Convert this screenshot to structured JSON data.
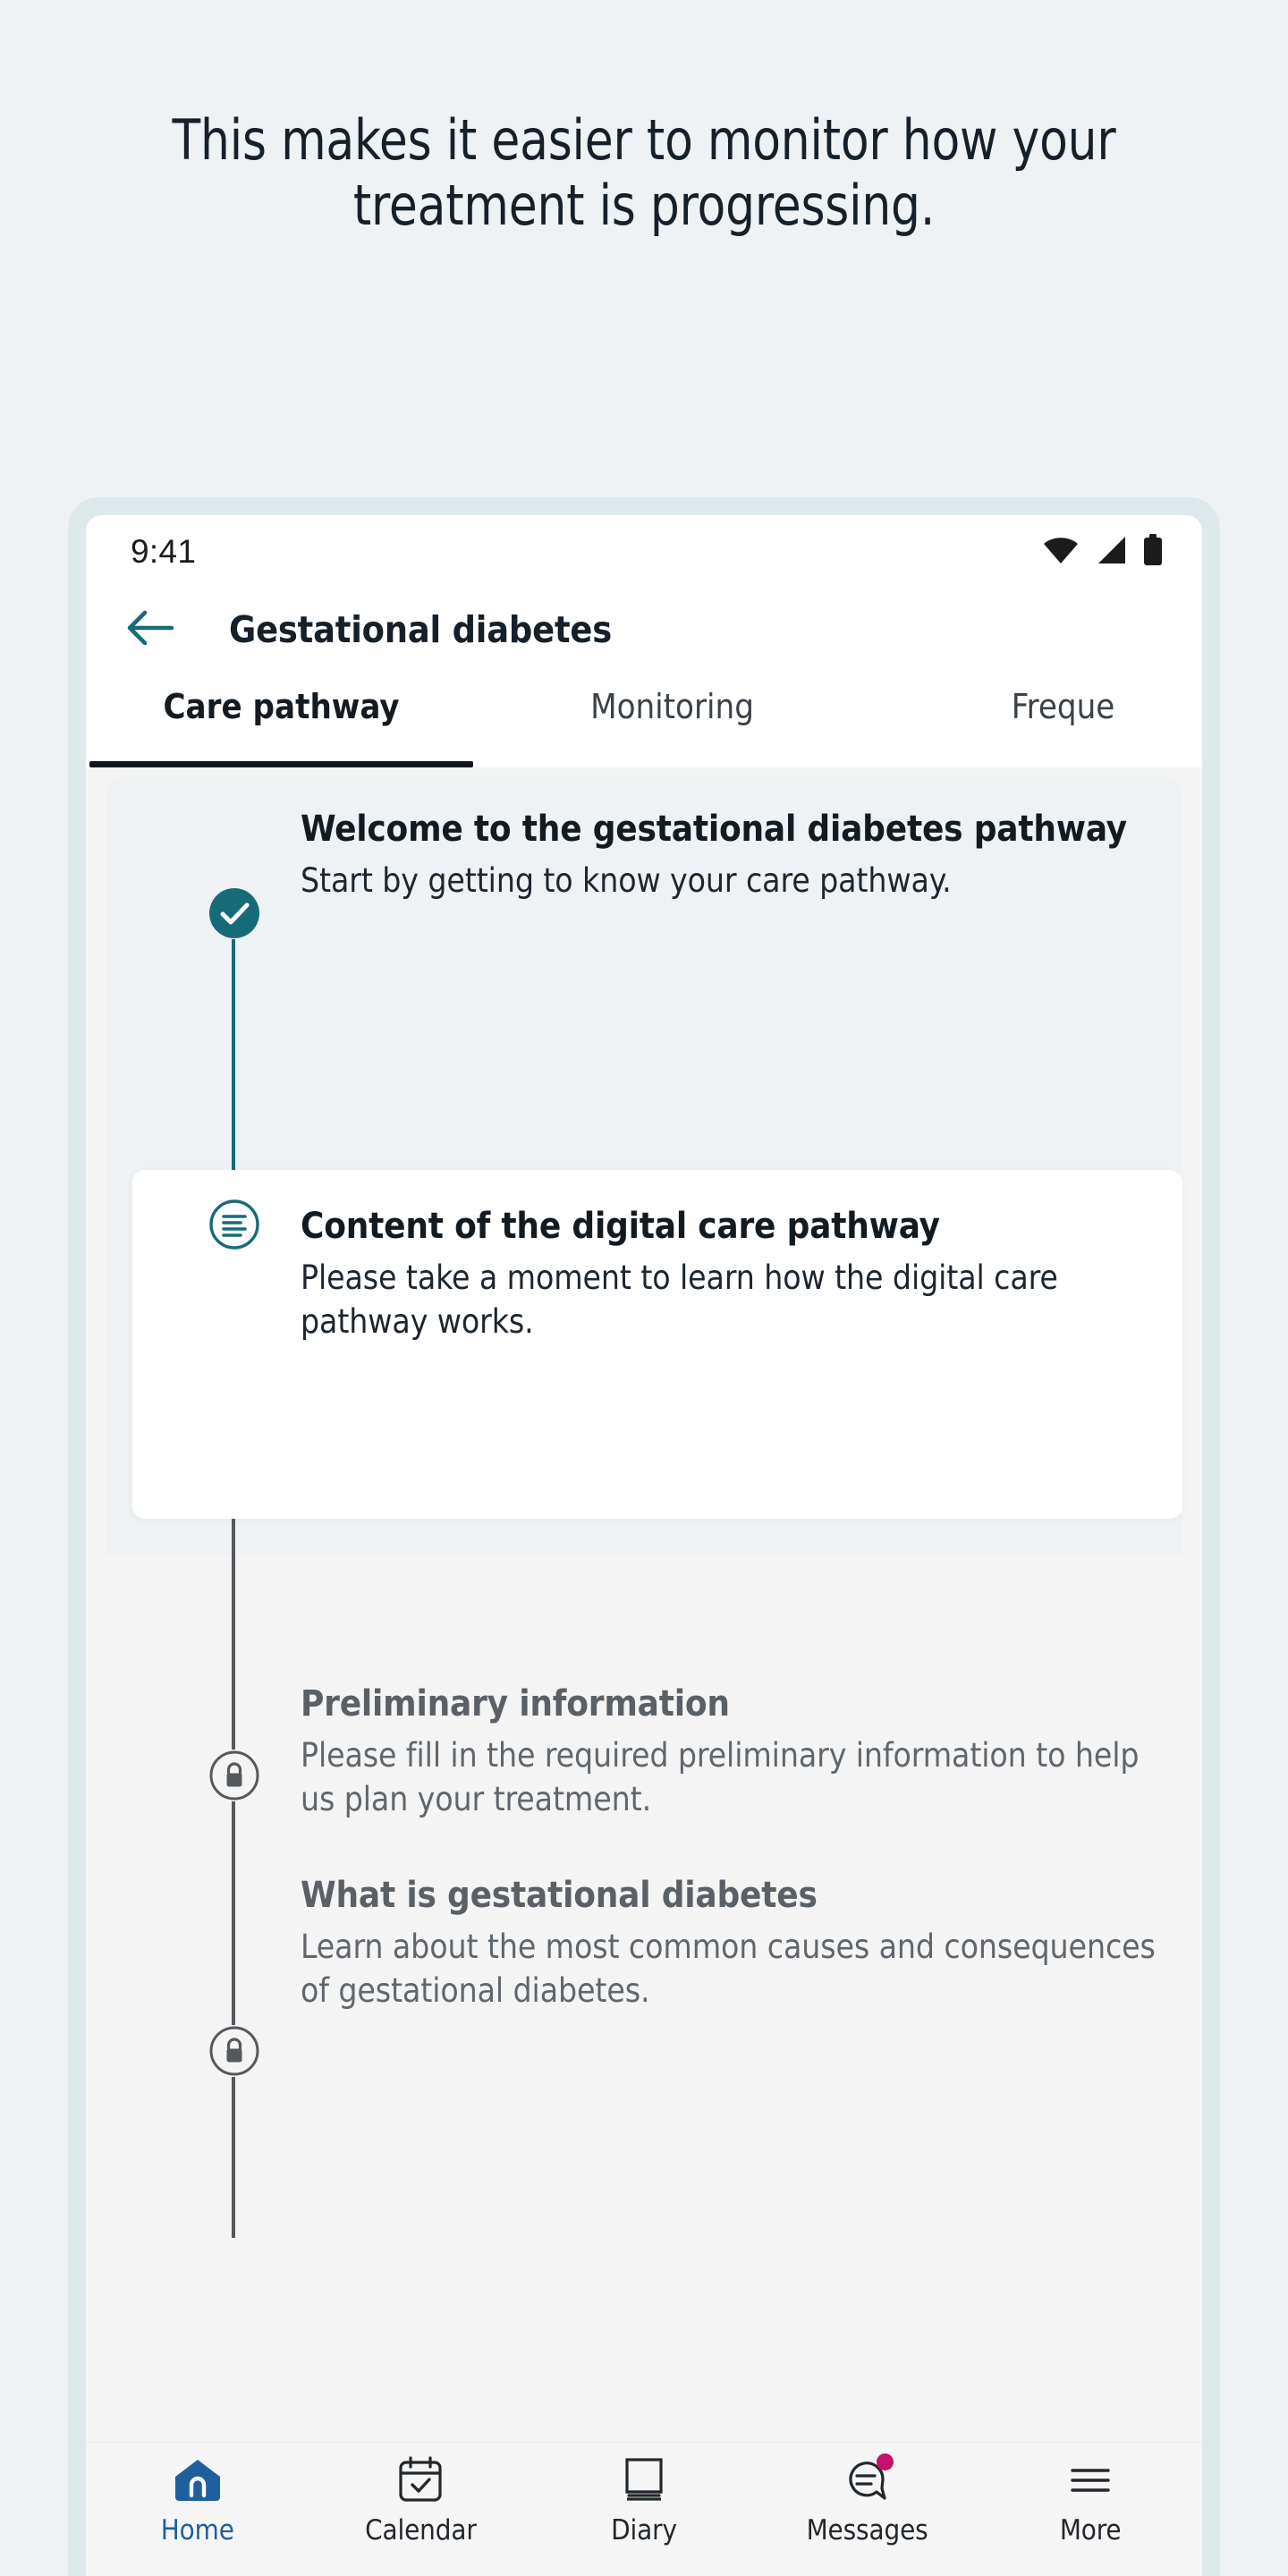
{
  "page": {
    "heading": "This makes it easier to monitor how your treatment is progressing."
  },
  "colors": {
    "page_background": "#eef2f5",
    "phone_frame": "#dde9eb",
    "teal_accent": "#176b78",
    "nav_active_blue": "#1f5f9e",
    "badge_magenta": "#c4136a",
    "locked_gray": "#5a6067"
  },
  "status_bar": {
    "time": "9:41",
    "icons": [
      "wifi-icon",
      "cellular-signal-icon",
      "battery-icon"
    ]
  },
  "app_bar": {
    "back_icon": "arrow-left-icon",
    "title": "Gestational diabetes"
  },
  "tabs": [
    {
      "label": "Care pathway",
      "active": true
    },
    {
      "label": "Monitoring",
      "active": false
    },
    {
      "label": "Freque",
      "active": false
    }
  ],
  "timeline": [
    {
      "icon": "check-circle-icon",
      "state": "completed",
      "title": "Welcome to the gestational diabetes pathway",
      "description": "Start by getting to know your care pathway."
    },
    {
      "icon": "document-lines-icon",
      "state": "current",
      "title": "Content of the digital care pathway",
      "description": "Please take a moment to learn how the digital care pathway works."
    },
    {
      "icon": "lock-icon",
      "state": "locked",
      "title": "Preliminary information",
      "description": "Please fill in the required preliminary information to help us plan your treatment."
    },
    {
      "icon": "lock-icon",
      "state": "locked",
      "title": "What is gestational diabetes",
      "description": "Learn about the most common causes and consequences of gestational diabetes."
    }
  ],
  "bottom_nav": [
    {
      "label": "Home",
      "icon": "home-icon",
      "active": true,
      "badge": false
    },
    {
      "label": "Calendar",
      "icon": "calendar-check-icon",
      "active": false,
      "badge": false
    },
    {
      "label": "Diary",
      "icon": "book-icon",
      "active": false,
      "badge": false
    },
    {
      "label": "Messages",
      "icon": "speech-bubble-icon",
      "active": false,
      "badge": true
    },
    {
      "label": "More",
      "icon": "hamburger-menu-icon",
      "active": false,
      "badge": false
    }
  ]
}
